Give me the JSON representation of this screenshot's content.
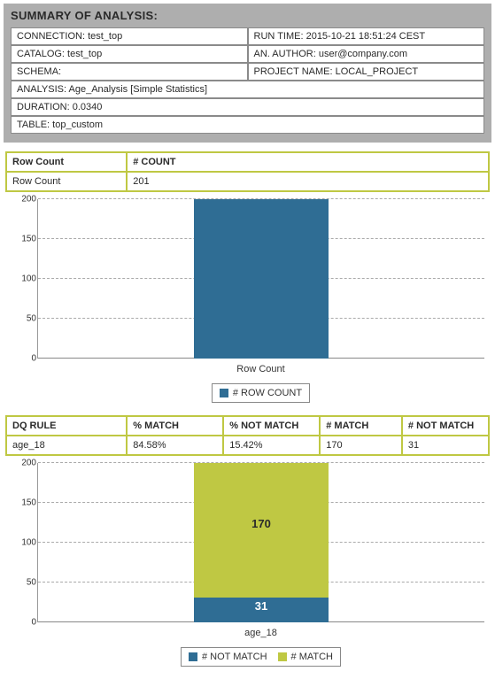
{
  "summary": {
    "title": "SUMMARY OF ANALYSIS:",
    "connection_label": "CONNECTION: ",
    "connection_value": "test_top",
    "runtime_label": "RUN TIME: ",
    "runtime_value": "2015-10-21 18:51:24 CEST",
    "catalog_label": "CATALOG: ",
    "catalog_value": "test_top",
    "author_label": "AN. AUTHOR: ",
    "author_value": "user@company.com",
    "schema_label": "SCHEMA:",
    "schema_value": "",
    "project_label": "PROJECT NAME: ",
    "project_value": "LOCAL_PROJECT",
    "analysis_label": "ANALYSIS: ",
    "analysis_value": "Age_Analysis [Simple Statistics]",
    "duration_label": "DURATION: ",
    "duration_value": "0.0340",
    "table_label": "TABLE: ",
    "table_value": "top_custom"
  },
  "rowcount_table": {
    "head": [
      "Row Count",
      "# COUNT"
    ],
    "row": [
      "Row Count",
      "201"
    ]
  },
  "dqrule_table": {
    "head": [
      "DQ RULE",
      "% MATCH",
      "% NOT MATCH",
      "# MATCH",
      "# NOT MATCH"
    ],
    "row": [
      "age_18",
      "84.58%",
      "15.42%",
      "170",
      "31"
    ]
  },
  "colors": {
    "blue": "#2f6d94",
    "olive": "#bfc843"
  },
  "chart1": {
    "ticks": [
      "200",
      "150",
      "100",
      "50",
      "0"
    ],
    "xlabel": "Row Count",
    "legend": "# ROW COUNT",
    "value": 201,
    "ymax": 200
  },
  "chart2": {
    "ticks": [
      "200",
      "150",
      "100",
      "50",
      "0"
    ],
    "xlabel": "age_18",
    "legend_not": "# NOT MATCH",
    "legend_match": "# MATCH",
    "match_value": 170,
    "not_match_value": 31,
    "match_label": "170",
    "not_match_label": "31",
    "ymax": 200
  },
  "chart_data": [
    {
      "type": "bar",
      "title": "",
      "categories": [
        "Row Count"
      ],
      "series": [
        {
          "name": "# ROW COUNT",
          "values": [
            201
          ],
          "color": "#2f6d94"
        }
      ],
      "xlabel": "Row Count",
      "ylabel": "",
      "ylim": [
        0,
        200
      ],
      "yticks": [
        0,
        50,
        100,
        150,
        200
      ],
      "stacked": false,
      "legend_position": "bottom"
    },
    {
      "type": "bar",
      "title": "",
      "categories": [
        "age_18"
      ],
      "series": [
        {
          "name": "# NOT MATCH",
          "values": [
            31
          ],
          "color": "#2f6d94"
        },
        {
          "name": "# MATCH",
          "values": [
            170
          ],
          "color": "#bfc843"
        }
      ],
      "xlabel": "age_18",
      "ylabel": "",
      "ylim": [
        0,
        200
      ],
      "yticks": [
        0,
        50,
        100,
        150,
        200
      ],
      "stacked": true,
      "data_labels": [
        31,
        170
      ],
      "legend_position": "bottom"
    }
  ]
}
